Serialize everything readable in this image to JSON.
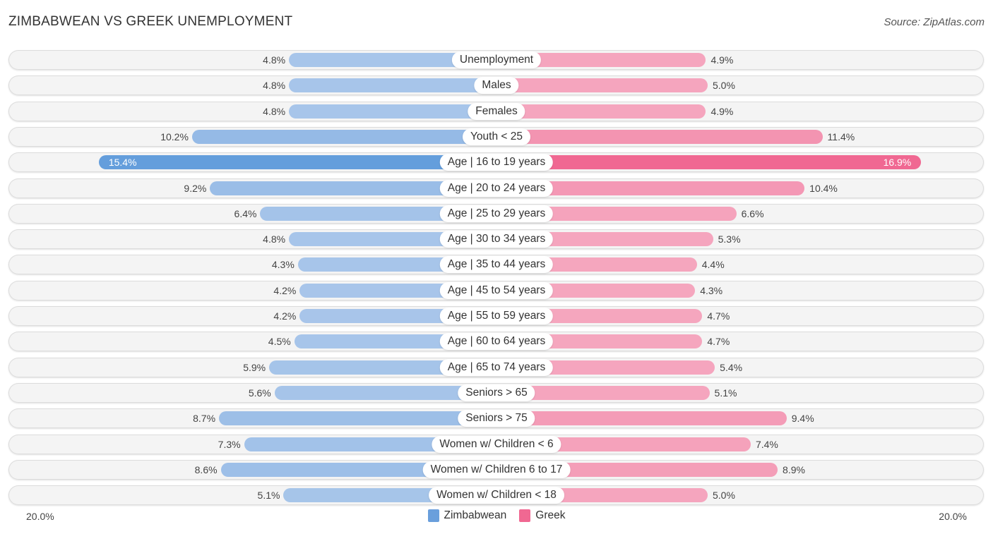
{
  "header": {
    "title": "ZIMBABWEAN VS GREEK UNEMPLOYMENT",
    "source": "Source: ZipAtlas.com"
  },
  "colors": {
    "zimbabwean": "#6a9fdc",
    "zimbabwean_light": "#a9c6ea",
    "greek": "#f06892",
    "greek_light": "#f5a7bf"
  },
  "chart_data": {
    "type": "bar",
    "orientation": "horizontal-diverging",
    "title": "ZIMBABWEAN VS GREEK UNEMPLOYMENT",
    "categories": [
      "Unemployment",
      "Males",
      "Females",
      "Youth < 25",
      "Age | 16 to 19 years",
      "Age | 20 to 24 years",
      "Age | 25 to 29 years",
      "Age | 30 to 34 years",
      "Age | 35 to 44 years",
      "Age | 45 to 54 years",
      "Age | 55 to 59 years",
      "Age | 60 to 64 years",
      "Age | 65 to 74 years",
      "Seniors > 65",
      "Seniors > 75",
      "Women w/ Children < 6",
      "Women w/ Children 6 to 17",
      "Women w/ Children < 18"
    ],
    "series": [
      {
        "name": "Zimbabwean",
        "side": "left",
        "values": [
          4.8,
          4.8,
          4.8,
          10.2,
          15.4,
          9.2,
          6.4,
          4.8,
          4.3,
          4.2,
          4.2,
          4.5,
          5.9,
          5.6,
          8.7,
          7.3,
          8.6,
          5.1
        ]
      },
      {
        "name": "Greek",
        "side": "right",
        "values": [
          4.9,
          5.0,
          4.9,
          11.4,
          16.9,
          10.4,
          6.6,
          5.3,
          4.4,
          4.3,
          4.7,
          4.7,
          5.4,
          5.1,
          9.4,
          7.4,
          8.9,
          5.0
        ]
      }
    ],
    "value_labels": {
      "Zimbabwean": [
        "4.8%",
        "4.8%",
        "4.8%",
        "10.2%",
        "15.4%",
        "9.2%",
        "6.4%",
        "4.8%",
        "4.3%",
        "4.2%",
        "4.2%",
        "4.5%",
        "5.9%",
        "5.6%",
        "8.7%",
        "7.3%",
        "8.6%",
        "5.1%"
      ],
      "Greek": [
        "4.9%",
        "5.0%",
        "4.9%",
        "11.4%",
        "16.9%",
        "10.4%",
        "6.6%",
        "5.3%",
        "4.4%",
        "4.3%",
        "4.7%",
        "4.7%",
        "5.4%",
        "5.1%",
        "9.4%",
        "7.4%",
        "8.9%",
        "5.0%"
      ]
    },
    "axis": {
      "left_label": "20.0%",
      "right_label": "20.0%",
      "max": 20.0
    },
    "legend": {
      "position": "bottom-center",
      "entries": [
        "Zimbabwean",
        "Greek"
      ]
    }
  }
}
